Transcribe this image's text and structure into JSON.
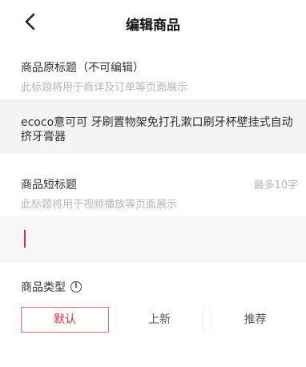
{
  "nav": {
    "title": "编辑商品",
    "back_icon": "chevron-left-icon"
  },
  "original_title": {
    "label": "商品原标题（不可编辑）",
    "hint": "此标题将用于商详及订单等页面展示",
    "value": "ecoco意可可 牙刷置物架免打孔漱口刷牙杯壁挂式自动挤牙膏器"
  },
  "short_title": {
    "label": "商品短标题",
    "limit": "最多10字",
    "hint": "此标题将用于视频播放等页面展示",
    "value": ""
  },
  "product_type": {
    "label": "商品类型",
    "info_icon": "ⓘ",
    "options": [
      "默认",
      "上新",
      "推荐"
    ],
    "selected": "默认"
  },
  "colors": {
    "accent": "#d92a3c",
    "accent_border": "#e06a73",
    "hint": "#b7b7b7"
  }
}
